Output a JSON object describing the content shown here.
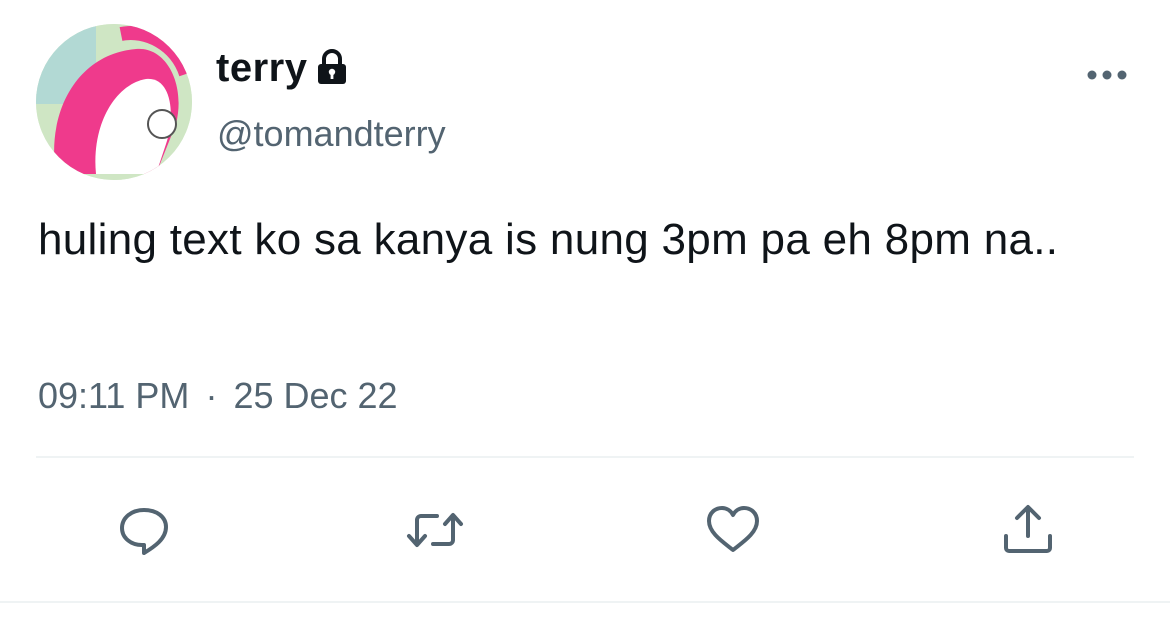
{
  "tweet": {
    "display_name": "terry",
    "handle": "@tomandterry",
    "text": "huling text ko sa kanya is nung 3pm pa eh 8pm na..",
    "time": "09:11 PM",
    "separator": "·",
    "date": "25 Dec 22"
  },
  "icons": {
    "verified_lock": "lock-icon",
    "more": "more-horizontal-icon",
    "reply": "reply-icon",
    "retweet": "retweet-icon",
    "like": "heart-icon",
    "share": "share-icon"
  },
  "colors": {
    "text": "#0f1419",
    "secondary": "#536471",
    "divider": "#eff3f4"
  }
}
